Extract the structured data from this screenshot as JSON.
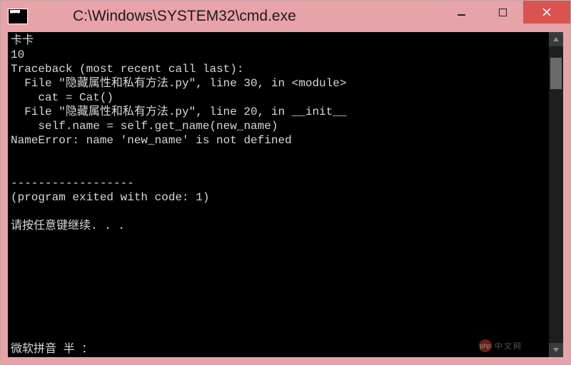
{
  "window": {
    "title": "C:\\Windows\\SYSTEM32\\cmd.exe"
  },
  "console": {
    "lines": [
      "卡卡",
      "10",
      "Traceback (most recent call last):",
      "  File \"隐藏属性和私有方法.py\", line 30, in <module>",
      "    cat = Cat()",
      "  File \"隐藏属性和私有方法.py\", line 20, in __init__",
      "    self.name = self.get_name(new_name)",
      "NameError: name 'new_name' is not defined",
      "",
      "",
      "------------------",
      "(program exited with code: 1)",
      "",
      "请按任意键继续. . ."
    ]
  },
  "ime": {
    "status": "微软拼音 半 ："
  },
  "watermark": {
    "badge": "php",
    "text": "中文网"
  }
}
